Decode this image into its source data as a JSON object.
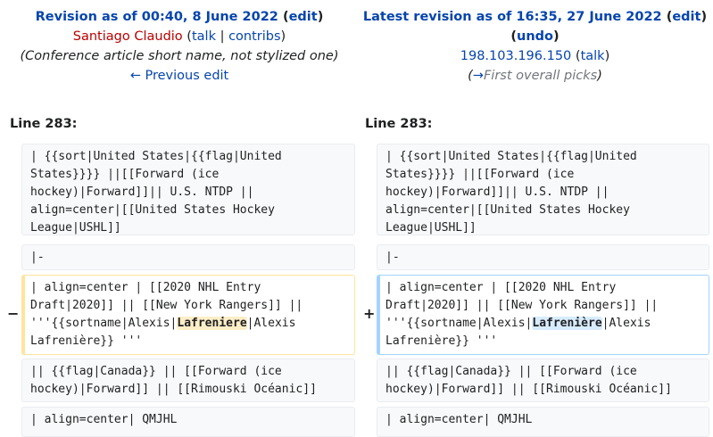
{
  "left_header": {
    "revision_prefix": "Revision as of 00:40, 8 June 2022",
    "edit_label": "edit",
    "user": "Santiago Claudio",
    "talk_label": "talk",
    "contribs_label": "contribs",
    "summary": "(Conference article short name, not stylized one)",
    "prev_edit": "← Previous edit"
  },
  "right_header": {
    "revision_prefix": "Latest revision as of 16:35, 27 June 2022",
    "edit_label": "edit",
    "undo_label": "undo",
    "user": "198.103.196.150",
    "talk_label": "talk",
    "summary_arrow": "→",
    "summary_section": "First overall picks"
  },
  "line_left": "Line 283:",
  "line_right": "Line 283:",
  "markers": {
    "removed": "−",
    "added": "+"
  },
  "diff": {
    "row1": "| {{sort|United States|{{flag|United\nStates}}}} ||[[Forward (ice\nhockey)|Forward]]|| U.S. NTDP ||\nalign=center|[[United States Hockey\nLeague|USHL]]",
    "row2": "|-",
    "changed_pre": "| align=center | [[2020 NHL Entry\nDraft|2020]] || [[New York Rangers]] ||\n'''{{sortname|Alexis|",
    "changed_left_word": "Lafreniere",
    "changed_right_word": "Lafrenière",
    "changed_post": "|Alexis\nLafrenière}} '''",
    "row4": "|| {{flag|Canada}} || [[Forward (ice\nhockey)|Forward]] || [[Rimouski Océanic]]",
    "row5": "| align=center| QMJHL"
  }
}
